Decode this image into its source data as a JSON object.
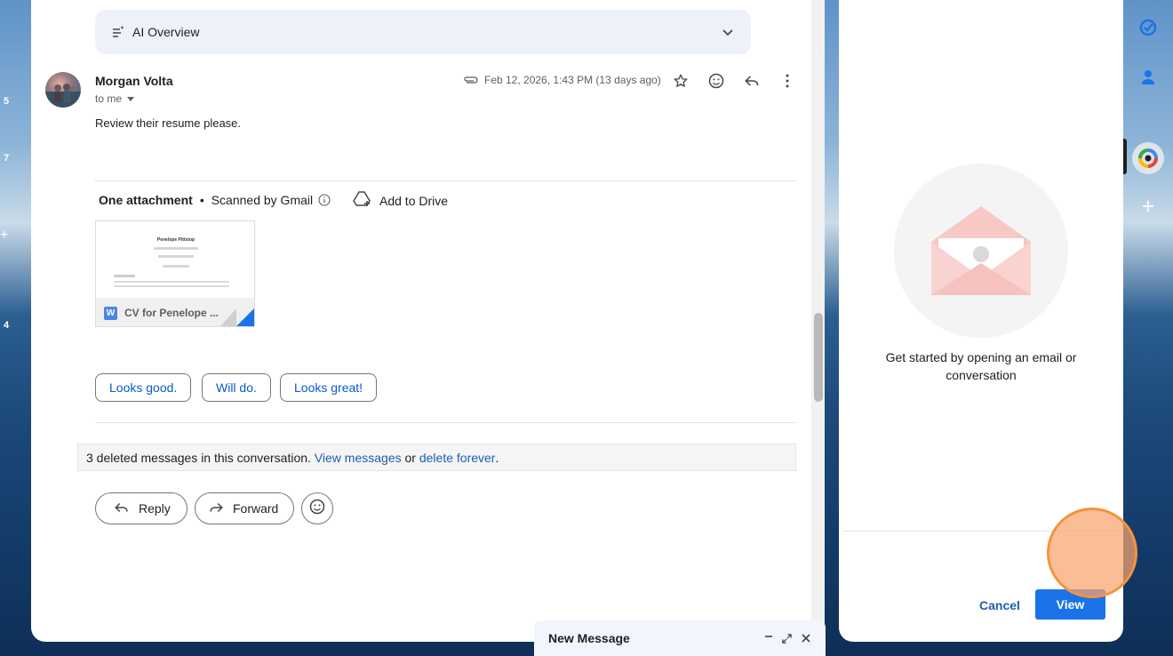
{
  "left_strip": {
    "numbers": [
      "5",
      "7",
      "4"
    ]
  },
  "ai_overview": {
    "label": "AI Overview"
  },
  "message": {
    "sender": "Morgan Volta",
    "recipient": "to me",
    "date": "Feb 12, 2026, 1:43 PM (13 days ago)",
    "body": "Review their resume please."
  },
  "attachments": {
    "title": "One attachment",
    "scanned": "Scanned by Gmail",
    "add_to_drive": "Add to Drive",
    "file": {
      "name": "CV for Penelope ...",
      "type_badge": "W",
      "preview_heading": "Penelope Pittstop"
    }
  },
  "smart_replies": [
    "Looks good.",
    "Will do.",
    "Looks great!"
  ],
  "deleted_notice": {
    "text": "3 deleted messages in this conversation.",
    "view_link": "View messages",
    "or_text": "or",
    "delete_link": "delete forever",
    "period": "."
  },
  "actions": {
    "reply": "Reply",
    "forward": "Forward"
  },
  "new_message": {
    "title": "New Message"
  },
  "side_panel": {
    "empty_text": "Get started by opening an email or conversation",
    "cancel": "Cancel",
    "view": "View"
  },
  "colors": {
    "accent": "#1a73e8",
    "link": "#1a5fb4",
    "marker": "#f5923e"
  }
}
